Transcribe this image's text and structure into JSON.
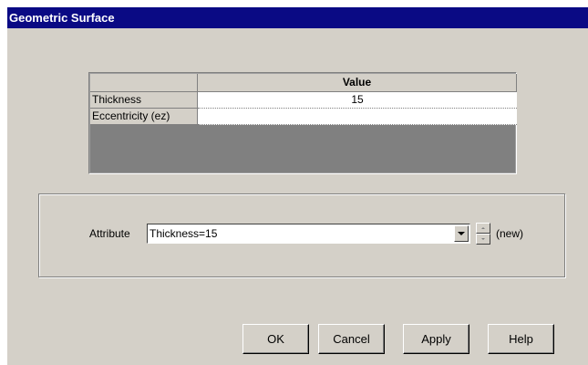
{
  "window": {
    "title": "Geometric Surface"
  },
  "grid": {
    "column_header": "Value",
    "rows": [
      {
        "label": "Thickness",
        "value": "15"
      },
      {
        "label": "Eccentricity (ez)",
        "value": ""
      }
    ]
  },
  "attribute": {
    "label": "Attribute",
    "selected": "Thickness=15",
    "status": "(new)"
  },
  "buttons": {
    "ok": "OK",
    "cancel": "Cancel",
    "apply": "Apply",
    "help": "Help"
  },
  "colors": {
    "titlebar": "#0a0a84",
    "face": "#d4d0c8"
  }
}
